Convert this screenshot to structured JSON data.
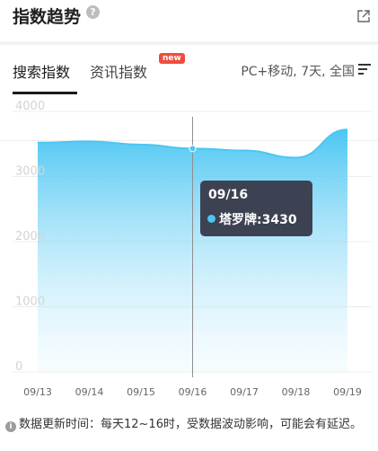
{
  "header": {
    "title": "指数趋势",
    "help_icon": "question-circle-icon",
    "share_icon": "external-link-icon"
  },
  "tabs": {
    "active": "搜索指数",
    "inactive": "资讯指数",
    "badge": "new"
  },
  "filter": {
    "label": "PC+移动, 7天, 全国",
    "icon": "filter-lines-icon"
  },
  "tooltip": {
    "date": "09/16",
    "series": "塔罗牌:3430"
  },
  "footer": {
    "note": "数据更新时间：每天12~16时，受数据波动影响，可能会有延迟。"
  },
  "chart_data": {
    "type": "area",
    "x": [
      "09/13",
      "09/14",
      "09/15",
      "09/16",
      "09/17",
      "09/18",
      "09/19"
    ],
    "series": [
      {
        "name": "塔罗牌",
        "values": [
          3520,
          3540,
          3490,
          3430,
          3400,
          3290,
          3720
        ]
      }
    ],
    "y_ticks": [
      0,
      1000,
      2000,
      3000,
      4000
    ],
    "ylim": [
      0,
      4000
    ],
    "highlight_index": 3,
    "color": "#4cc6f3"
  }
}
